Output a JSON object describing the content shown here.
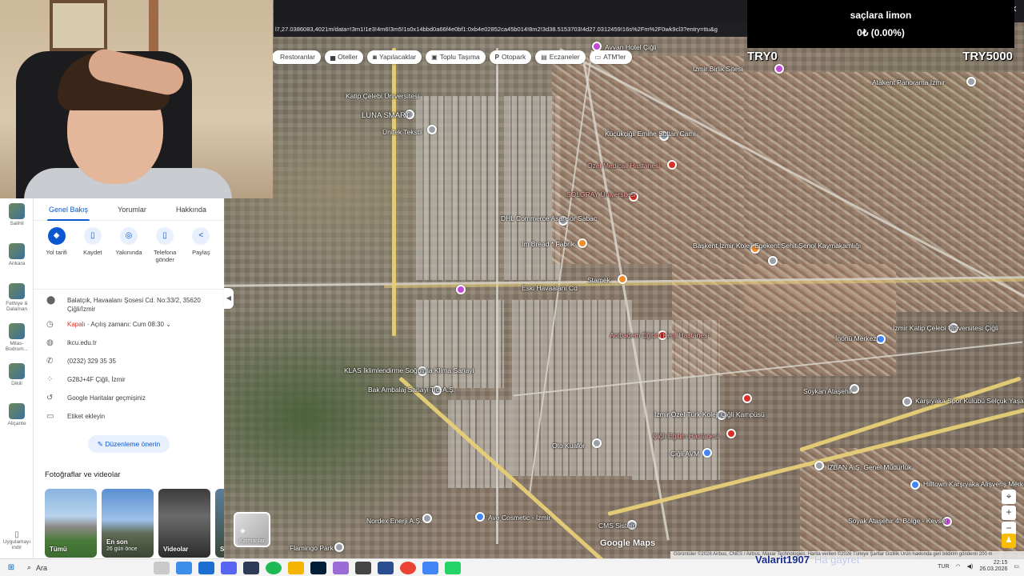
{
  "browser": {
    "url": "l7,27.0386083,4021m/data=!3m1!1e3!4m6!3m5!1s0x14bbd0a66f4e0bf1:0xb4e02852ca45b014!8m2!3d38.5153703!4d27.0312459!16s%2Fm%2F0wk9cl3?entry=ttu&g",
    "controls": {
      "minimize": "–",
      "maximize": "▢",
      "close": "✕"
    }
  },
  "chips": [
    {
      "icon": "restaurant-icon",
      "glyph": "",
      "label": "Restoranlar"
    },
    {
      "icon": "hotel-icon",
      "glyph": "▅",
      "label": "Oteller"
    },
    {
      "icon": "camera-icon",
      "glyph": "◙",
      "label": "Yapılacaklar"
    },
    {
      "icon": "transit-icon",
      "glyph": "▣",
      "label": "Toplu Taşıma"
    },
    {
      "icon": "parking-icon",
      "glyph": "P",
      "label": "Otopark"
    },
    {
      "icon": "pharmacy-icon",
      "glyph": "▤",
      "label": "Eczaneler"
    },
    {
      "icon": "atm-icon",
      "glyph": "▭",
      "label": "ATM'ler"
    }
  ],
  "donation": {
    "name": "saçlara limon",
    "amount": "0₺ (0.00%)",
    "goal_left": "TRY0",
    "goal_right": "TRY5000"
  },
  "rail": {
    "items": [
      {
        "label": "Salihli"
      },
      {
        "label": "Ankara"
      },
      {
        "label": "Fethiye & Dalaman"
      },
      {
        "label": "Milas-Bodrum..."
      },
      {
        "label": "Dikili"
      },
      {
        "label": "Aliçante"
      }
    ],
    "download_label": "Uygulamayı indir"
  },
  "panel": {
    "tabs": [
      "Genel Bakış",
      "Yorumlar",
      "Hakkında"
    ],
    "actions": [
      {
        "icon": "directions-icon",
        "glyph": "◆",
        "label": "Yol tarifi"
      },
      {
        "icon": "bookmark-icon",
        "glyph": "▯",
        "label": "Kaydet"
      },
      {
        "icon": "nearby-icon",
        "glyph": "◎",
        "label": "Yakınında"
      },
      {
        "icon": "send-to-phone-icon",
        "glyph": "▯",
        "label": "Telefona gönder"
      },
      {
        "icon": "share-icon",
        "glyph": "<",
        "label": "Paylaş"
      }
    ],
    "address": "Balatçık, Havaalanı Şosesi Cd. No:33/2, 35620 Çiğli/İzmir",
    "hours_status": "Kapalı",
    "hours_detail": " · Açılış zamanı: Cum 08:30",
    "website": "ikcu.edu.tr",
    "phone": "(0232) 329 35 35",
    "plus_code": "G28J+4F Çiğli, İzmir",
    "history": "Google Haritalar geçmişiniz",
    "label_add": "Etiket ekleyin",
    "edit_button": "Düzenleme önerin",
    "photos_heading": "Fotoğraflar ve videolar",
    "photos": [
      {
        "title": "Tümü",
        "sub": ""
      },
      {
        "title": "En son",
        "sub": "26 gün önce"
      },
      {
        "title": "Videolar",
        "sub": ""
      },
      {
        "title": "Sa",
        "sub": ""
      }
    ]
  },
  "map": {
    "layers_label": "Katmanlar",
    "logo": "Google Maps",
    "attribution": "Görüntüler ©2026 Airbus, CNES / Airbus, Maxar Technologies, Harita verileri ©2026    Türkiye    Şartlar    Gizlilik    Ürün hakkında geri bildirim gönderin    200 m",
    "labels": {
      "l1": "Katip Çelebi Üniversitesi",
      "l2": "LUNA SMART",
      "l3": "Ünitek Tekstil",
      "l4": "Avvan Hotel Çiğli",
      "l5": "İzmir Birlik Sitesi",
      "l6": "Atakent Panorama İzmir",
      "l7": "Küçükçiğli Emine Sultan Cami",
      "l8": "Özel Medicali Hastanesi",
      "l9": "SOLGRAY Üniversitesi",
      "l10": "DHL Commerce Asansör Sabac",
      "l11": "Im Bread * Fabrik",
      "l12": "Eski Havaalanı Cd",
      "l13": "Stamek",
      "l14": "Başkent İzmir Koleji Egekent Şehit Şenol Kaymakamlığı",
      "l15": "Acıbadem Eğitim Kent Hastanesi",
      "l16": "İzmir Katip Çelebi Üniversitesi Çiğli",
      "l17": "KLAS İklimlendirme Soğutma Klima Sanayi",
      "l18": "Bak Ambalaj Sanayi Tic. A.Ş.",
      "l19": "İzmir Özel Türk Koleji Çiğli Kampüsü",
      "l20": "Çiğli Eğitim Hastanesi",
      "l21": "Çiğli AVM",
      "l22": "Soykan Ataşehir",
      "l23": "Karşıyaka Spor Kulübü Selçuk Yaşar",
      "l24": "İZBAN A.Ş. Genel Müdürlük",
      "l25": "Hilltown Karşıyaka Alışveriş Merkezi",
      "l26": "Soyak Ataşehir 4. Bölge - Kevser",
      "l27": "CMS Sistem",
      "l28": "Nordex Enerji A.Ş.",
      "l29": "Ave Cosmetic - İzmir",
      "l30": "Flamingo Park",
      "l31": "İnönü Merkezi",
      "l32": "Oto Kuaför"
    }
  },
  "taskbar": {
    "search_placeholder": "Ara",
    "overlay_name": "Valarit1907",
    "overlay_sub": "Hâ gayret",
    "lang": "TUR",
    "time": "22:15",
    "date": "26.03.2026"
  },
  "colors": {
    "accent": "#0b57d0",
    "closed": "#d93025",
    "highway": "#e7cf77"
  }
}
